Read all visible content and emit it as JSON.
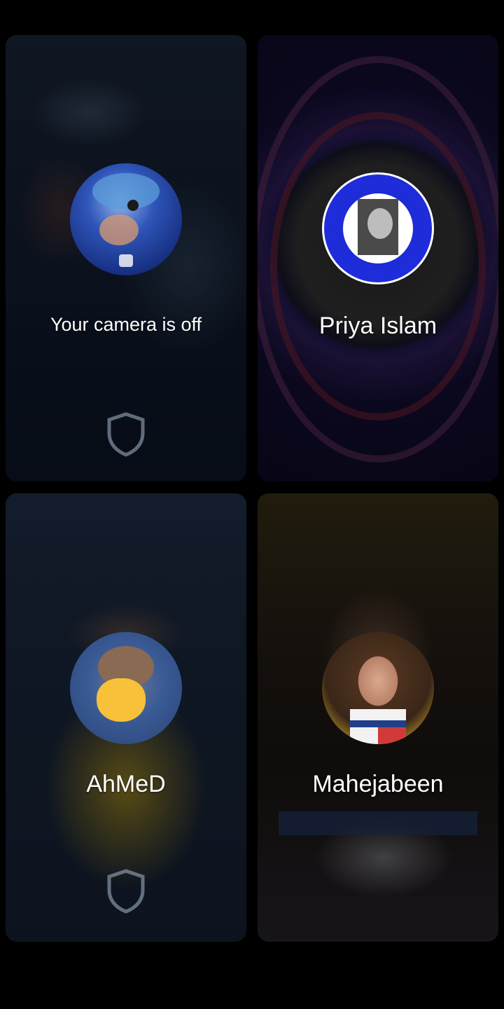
{
  "tiles": {
    "self": {
      "label": "Your camera is off"
    },
    "priya": {
      "name": "Priya Islam"
    },
    "ahmed": {
      "name": "AhMeD"
    },
    "mahe": {
      "name": "Mahejabeen"
    }
  },
  "icons": {
    "shield": "shield-icon",
    "cat_sticker": "cat-face-icon"
  },
  "colors": {
    "screen_bg": "#000000",
    "name_text": "#ffffff"
  }
}
